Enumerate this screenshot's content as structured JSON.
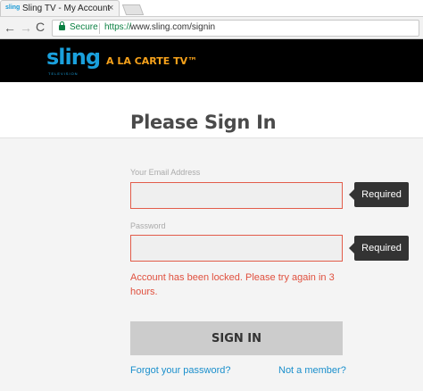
{
  "browser": {
    "tab_title": "Sling TV - My Account",
    "tab_favicon_text": "sling",
    "close_glyph": "×",
    "back_glyph": "←",
    "forward_glyph": "→",
    "reload_glyph": "C",
    "secure_label": "Secure",
    "url_scheme": "https://",
    "url_rest": "www.sling.com/signin"
  },
  "header": {
    "logo_text": "sling",
    "logo_subtext": "TELEVISION",
    "tagline": "A LA CARTE TV™",
    "brand_color": "#1aa0dc",
    "accent_color": "#f7a21b"
  },
  "page": {
    "title": "Please Sign In"
  },
  "form": {
    "email_label": "Your Email Address",
    "email_value": "",
    "password_label": "Password",
    "password_value": "",
    "email_tooltip": "Required",
    "password_tooltip": "Required",
    "error_message": "Account has been locked. Please try again in 3 hours.",
    "error_color": "#e0503e",
    "submit_label": "SIGN IN",
    "forgot_link": "Forgot your password?",
    "member_link": "Not a member?"
  }
}
